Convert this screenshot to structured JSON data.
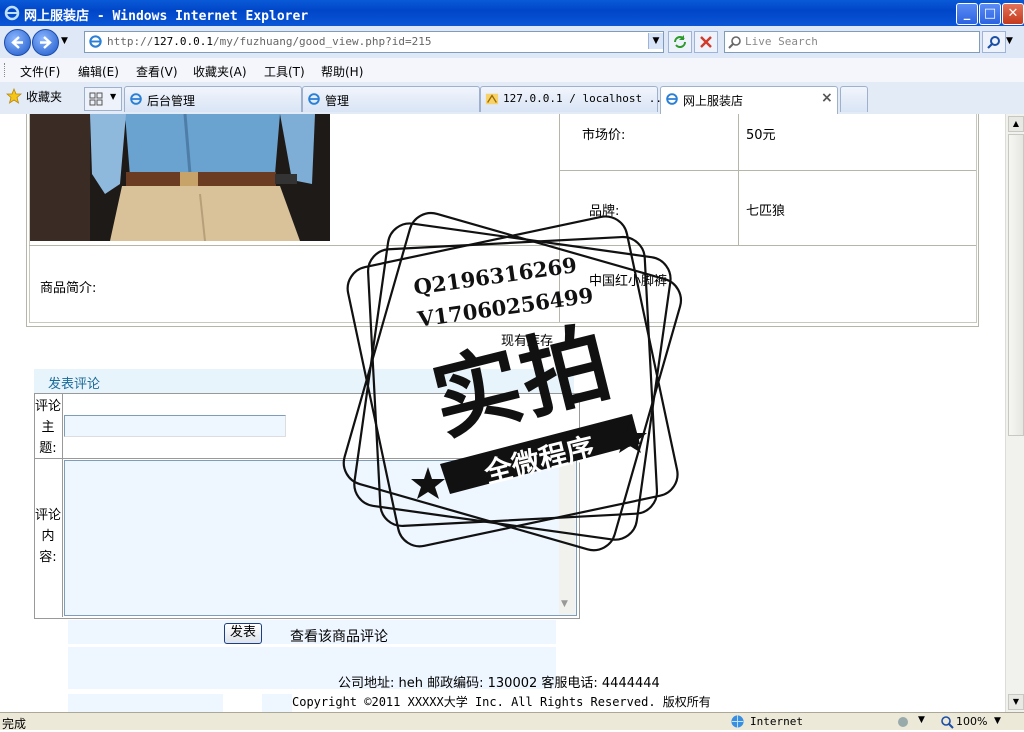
{
  "window": {
    "title": "网上服装店 - Windows Internet Explorer",
    "minimize": "_",
    "maximize": "□",
    "close": "✕"
  },
  "address_bar": {
    "url_prefix": "http://",
    "url_host": "127.0.0.1",
    "url_path": "/my/fuzhuang/good_view.php?id=215"
  },
  "search": {
    "placeholder": "Live Search"
  },
  "menu": {
    "items": [
      "文件(F)",
      "编辑(E)",
      "查看(V)",
      "收藏夹(A)",
      "工具(T)",
      "帮助(H)"
    ]
  },
  "favorites": {
    "label": "收藏夹"
  },
  "tabs": [
    {
      "label": "后台管理"
    },
    {
      "label": "管理"
    },
    {
      "label": "127.0.0.1 / localhost ..."
    },
    {
      "label": "网上服装店"
    }
  ],
  "product": {
    "market_price_label": "市场价:",
    "market_price_value": "50元",
    "brand_label": "品牌:",
    "brand_value": "七匹狼",
    "intro_label": "商品简介:",
    "intro_value": "中国红小脚裤",
    "stock_text": "现有库存"
  },
  "comment_form": {
    "header": "发表评论",
    "subject_label": "评论主题:",
    "content_label": "评论内容:",
    "submit_label": "发表",
    "view_comments_link": "查看该商品评论"
  },
  "footer": {
    "address_line": "公司地址: heh  邮政编码: 130002 客服电话: 4444444",
    "copyright": "Copyright ©2011 XXXXX大学 Inc. All Rights Reserved. 版权所有"
  },
  "watermark": {
    "qq": "Q2196316269",
    "vx": "V17060256499",
    "big_text": "实拍",
    "banner_text": "全微程序"
  },
  "status": {
    "left": "完成",
    "zone": "Internet",
    "zoom": "100%"
  },
  "colors": {
    "accent": "#0a56d6",
    "form_header_bg": "#e8f4fb",
    "form_header_text": "#1a6a9a"
  }
}
